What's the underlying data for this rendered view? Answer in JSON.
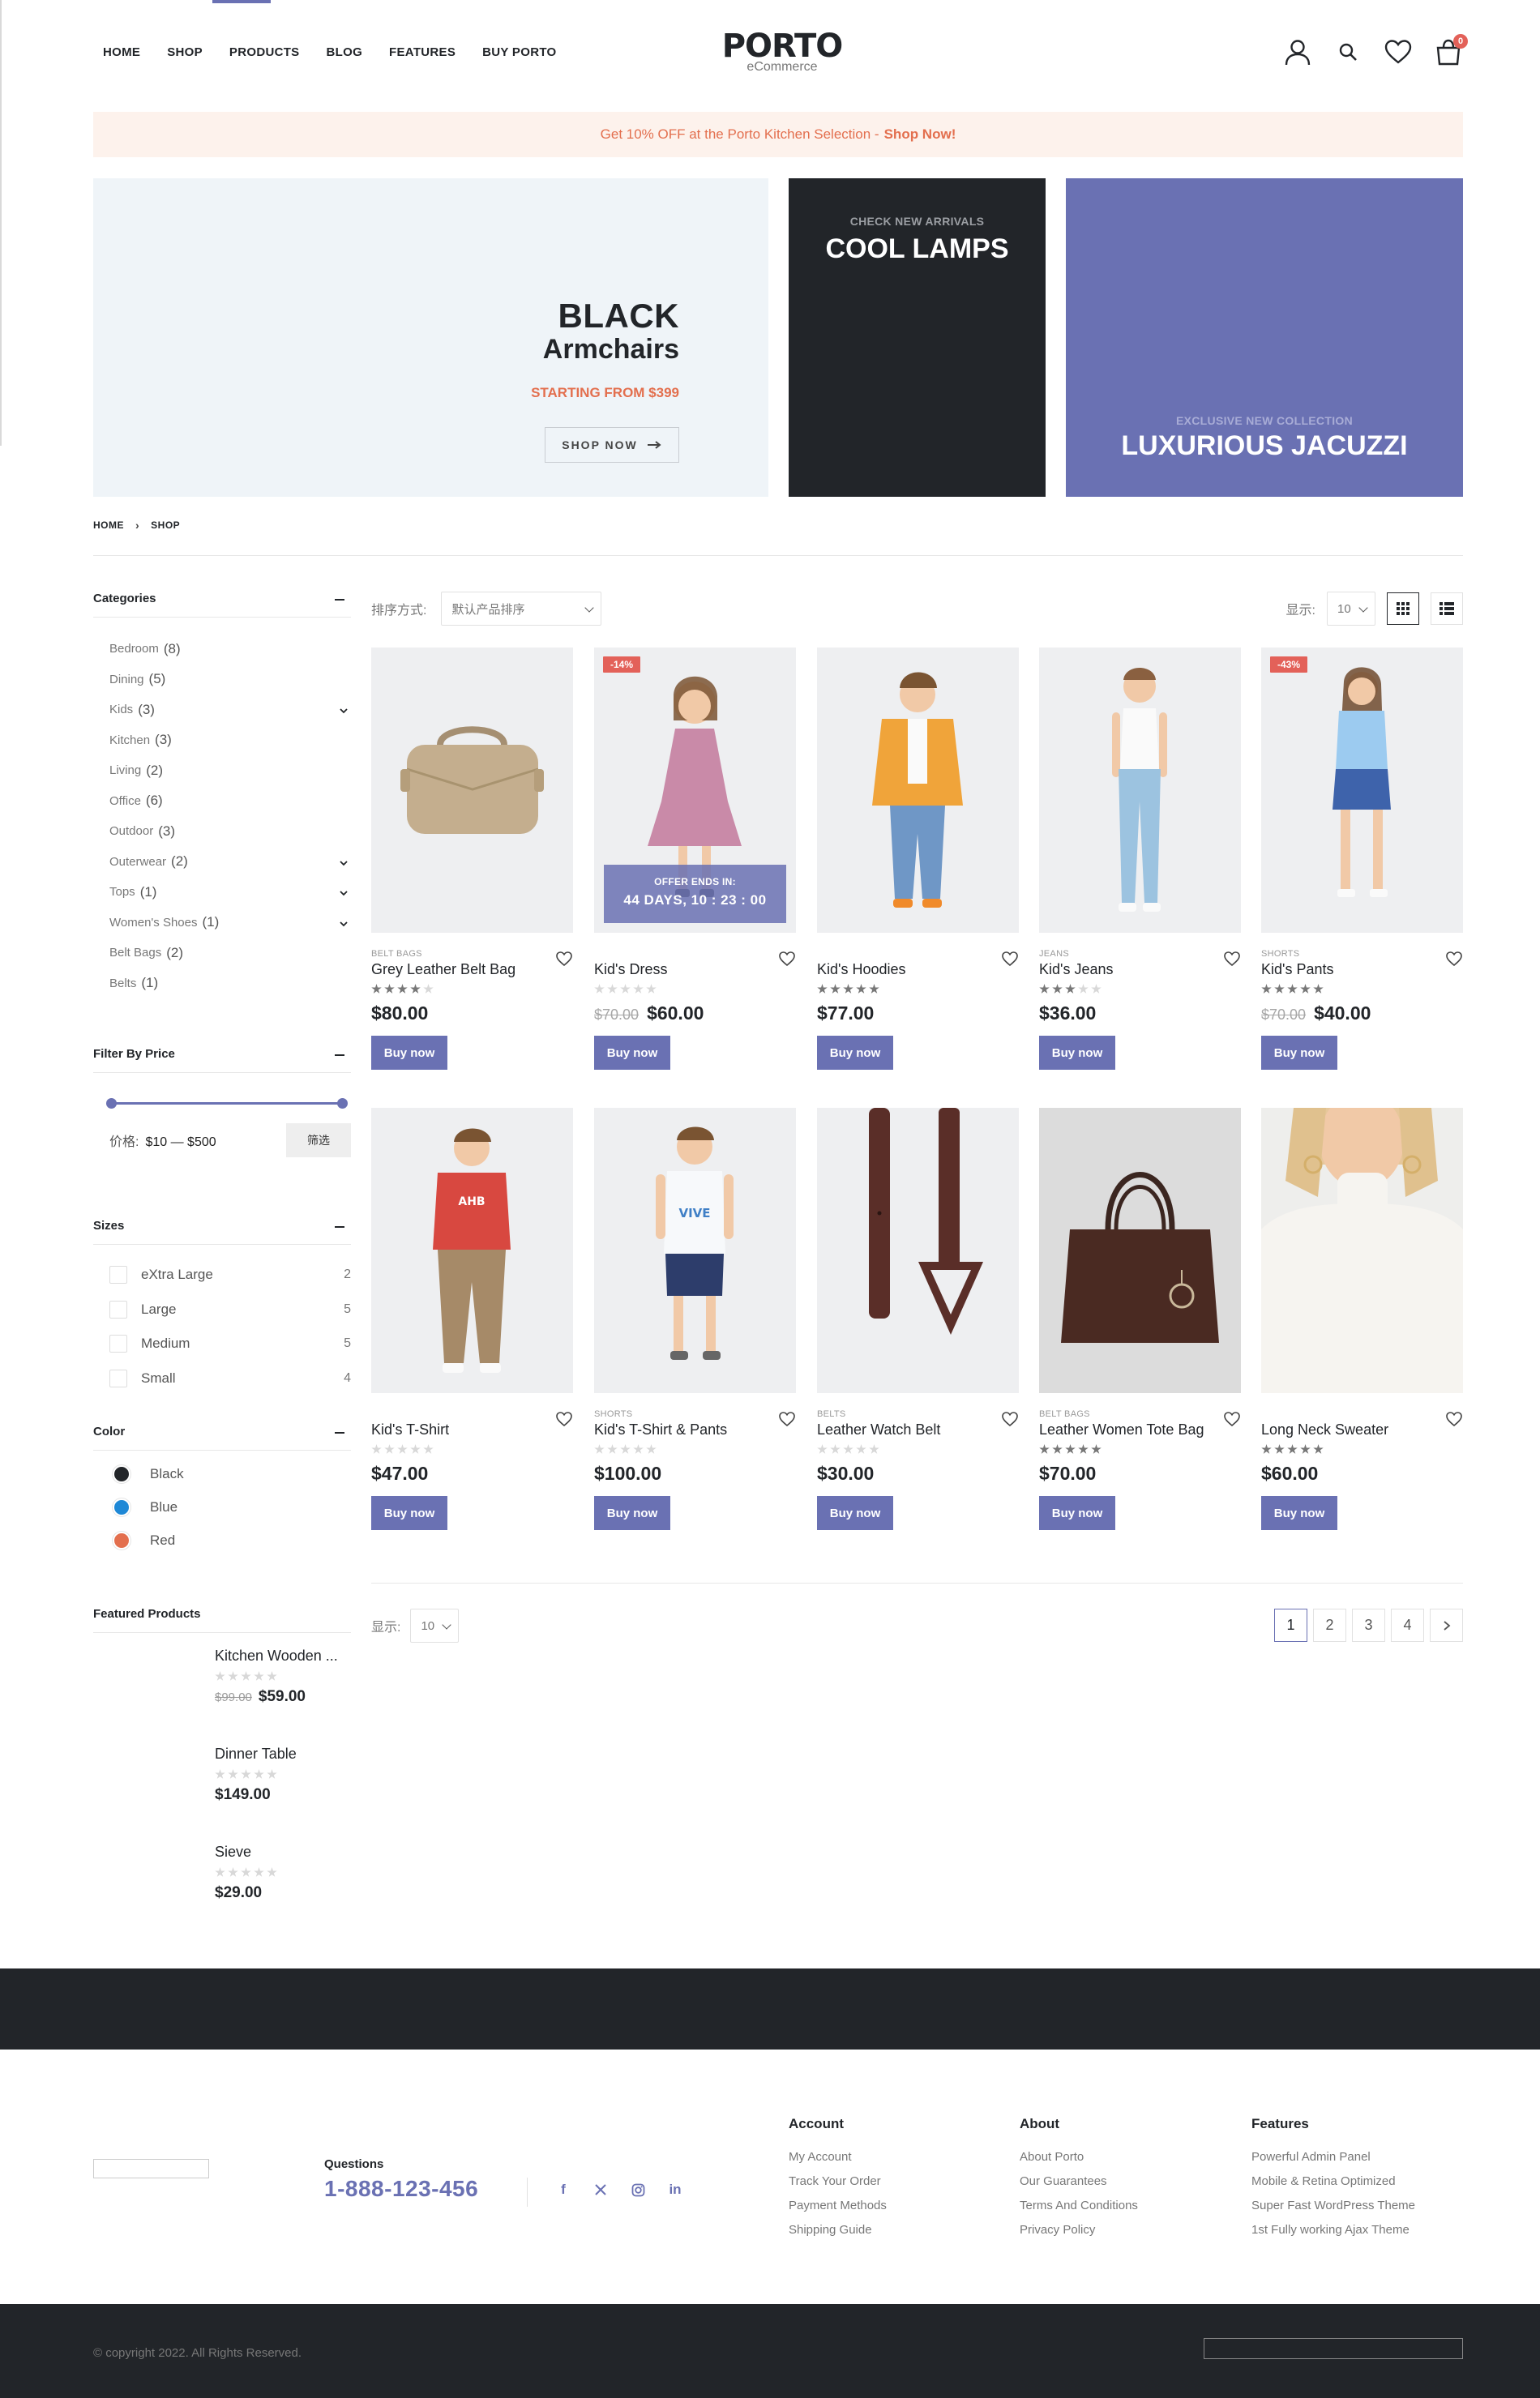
{
  "header": {
    "nav": [
      "HOME",
      "SHOP",
      "PRODUCTS",
      "BLOG",
      "FEATURES",
      "BUY PORTO"
    ],
    "logo_main": "PORTO",
    "logo_sub": "eCommerce",
    "cart_count": "0"
  },
  "promo": {
    "text": "Get 10% OFF at the Porto Kitchen Selection -",
    "link": "Shop Now!"
  },
  "banners": {
    "b1_title": "BLACK",
    "b1_subtitle": "Armchairs",
    "b1_price": "STARTING FROM $399",
    "b1_button": "SHOP NOW",
    "b2_kicker": "CHECK NEW ARRIVALS",
    "b2_title": "COOL LAMPS",
    "b3_kicker": "EXCLUSIVE NEW COLLECTION",
    "b3_title": "LUXURIOUS JACUZZI"
  },
  "breadcrumb": [
    "HOME",
    "SHOP"
  ],
  "sidebar": {
    "categories_title": "Categories",
    "categories": [
      {
        "name": "Bedroom",
        "count": "(8)",
        "expand": false
      },
      {
        "name": "Dining",
        "count": "(5)",
        "expand": false
      },
      {
        "name": "Kids",
        "count": "(3)",
        "expand": true
      },
      {
        "name": "Kitchen",
        "count": "(3)",
        "expand": false
      },
      {
        "name": "Living",
        "count": "(2)",
        "expand": false
      },
      {
        "name": "Office",
        "count": "(6)",
        "expand": false
      },
      {
        "name": "Outdoor",
        "count": "(3)",
        "expand": false
      },
      {
        "name": "Outerwear",
        "count": "(2)",
        "expand": true
      },
      {
        "name": "Tops",
        "count": "(1)",
        "expand": true
      },
      {
        "name": "Women's Shoes",
        "count": "(1)",
        "expand": true
      },
      {
        "name": "Belt Bags",
        "count": "(2)",
        "expand": false
      },
      {
        "name": "Belts",
        "count": "(1)",
        "expand": false
      }
    ],
    "price_title": "Filter By Price",
    "price_label": "价格:",
    "price_range": "$10 — $500",
    "filter_button": "筛选",
    "sizes_title": "Sizes",
    "sizes": [
      {
        "name": "eXtra Large",
        "count": "2"
      },
      {
        "name": "Large",
        "count": "5"
      },
      {
        "name": "Medium",
        "count": "5"
      },
      {
        "name": "Small",
        "count": "4"
      }
    ],
    "color_title": "Color",
    "colors": [
      {
        "name": "Black",
        "hex": "#222529"
      },
      {
        "name": "Blue",
        "hex": "#1e88d6"
      },
      {
        "name": "Red",
        "hex": "#e36f4e"
      }
    ],
    "featured_title": "Featured Products",
    "featured": [
      {
        "name": "Kitchen Wooden ...",
        "old_price": "$99.00",
        "price": "$59.00"
      },
      {
        "name": "Dinner Table",
        "old_price": "",
        "price": "$149.00"
      },
      {
        "name": "Sieve",
        "old_price": "",
        "price": "$29.00"
      }
    ]
  },
  "toolbar": {
    "sort_label": "排序方式:",
    "sort_value": "默认产品排序",
    "show_label": "显示:",
    "show_value": "10"
  },
  "products": [
    {
      "category": "BELT BAGS",
      "name": "Grey Leather Belt Bag",
      "old_price": "",
      "price": "$80.00",
      "rating": 4,
      "sale": "",
      "offer": false,
      "img": "bag-grey"
    },
    {
      "category": "",
      "name": "Kid's Dress",
      "old_price": "$70.00",
      "price": "$60.00",
      "rating": 0,
      "sale": "-14%",
      "offer": true,
      "img": "dress"
    },
    {
      "category": "",
      "name": "Kid's Hoodies",
      "old_price": "",
      "price": "$77.00",
      "rating": 5,
      "sale": "",
      "offer": false,
      "img": "hoodie"
    },
    {
      "category": "JEANS",
      "name": "Kid's Jeans",
      "old_price": "",
      "price": "$36.00",
      "rating": 3,
      "sale": "",
      "offer": false,
      "img": "jeans"
    },
    {
      "category": "SHORTS",
      "name": "Kid's Pants",
      "old_price": "$70.00",
      "price": "$40.00",
      "rating": 5,
      "sale": "-43%",
      "offer": false,
      "img": "pants"
    },
    {
      "category": "",
      "name": "Kid's T-Shirt",
      "old_price": "",
      "price": "$47.00",
      "rating": 0,
      "sale": "",
      "offer": false,
      "img": "tshirt"
    },
    {
      "category": "SHORTS",
      "name": "Kid's T-Shirt & Pants",
      "old_price": "",
      "price": "$100.00",
      "rating": 0,
      "sale": "",
      "offer": false,
      "img": "tshirt-pants"
    },
    {
      "category": "BELTS",
      "name": "Leather Watch Belt",
      "old_price": "",
      "price": "$30.00",
      "rating": 0,
      "sale": "",
      "offer": false,
      "img": "belt"
    },
    {
      "category": "BELT BAGS",
      "name": "Leather Women Tote Bag",
      "old_price": "",
      "price": "$70.00",
      "rating": 5,
      "sale": "",
      "offer": false,
      "img": "tote"
    },
    {
      "category": "",
      "name": "Long Neck Sweater",
      "old_price": "",
      "price": "$60.00",
      "rating": 5,
      "sale": "",
      "offer": false,
      "img": "sweater"
    }
  ],
  "offer": {
    "line1": "OFFER ENDS IN:",
    "line2": "44 DAYS, 10 : 23 : 00"
  },
  "buy_label": "Buy now",
  "pagination": [
    "1",
    "2",
    "3",
    "4"
  ],
  "footer": {
    "questions": "Questions",
    "phone": "1-888-123-456",
    "socials": [
      "facebook-icon",
      "x-icon",
      "instagram-icon",
      "linkedin-icon"
    ],
    "columns": [
      {
        "title": "Account",
        "links": [
          "My Account",
          "Track Your Order",
          "Payment Methods",
          "Shipping Guide"
        ]
      },
      {
        "title": "About",
        "links": [
          "About Porto",
          "Our Guarantees",
          "Terms And Conditions",
          "Privacy Policy"
        ]
      },
      {
        "title": "Features",
        "links": [
          "Powerful Admin Panel",
          "Mobile & Retina Optimized",
          "Super Fast WordPress Theme",
          "1st Fully working Ajax Theme"
        ]
      }
    ],
    "copyright": "© copyright 2022. All Rights Reserved."
  },
  "colors": {
    "accent": "#6a71b3",
    "sale": "#e36159",
    "promo": "#e36f4e",
    "dark": "#222529"
  }
}
